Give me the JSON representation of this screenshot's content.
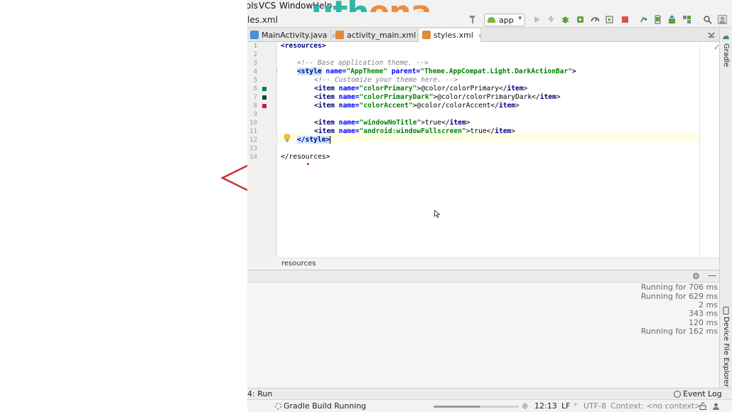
{
  "menu": {
    "items": [
      "ols",
      "VCS",
      "Window",
      "Help"
    ]
  },
  "logo": {
    "text": [
      "u",
      "t",
      "h",
      "e",
      "n",
      "a"
    ],
    "colors": [
      "#2fb6a6",
      "#2fb6a6",
      "#2fb6a6",
      "#f08a3a",
      "#f08a3a",
      "#f08a3a"
    ]
  },
  "toolbar": {
    "file_crumb": "les.xml",
    "run_config": "app",
    "icons": [
      "hammer-icon",
      "run-icon",
      "debug-icon",
      "apply-changes-icon",
      "profile-icon",
      "attach-icon",
      "stop-icon",
      "sync-gradle-icon",
      "avd-manager-icon",
      "sdk-manager-icon",
      "search-icon",
      "user-icon"
    ]
  },
  "tabs": [
    {
      "label": "MainActivity.java",
      "icon": "class-icon",
      "color": "#4a8fd6",
      "active": false
    },
    {
      "label": "activity_main.xml",
      "icon": "layout-icon",
      "color": "#e08a3a",
      "active": false
    },
    {
      "label": "styles.xml",
      "icon": "xml-icon",
      "color": "#e08a3a",
      "active": true
    }
  ],
  "editor": {
    "line_numbers": [
      "1",
      "2",
      "3",
      "4",
      "5",
      "6",
      "7",
      "8",
      "9",
      "10",
      "11",
      "12",
      "13",
      "14"
    ],
    "swatches": [
      {
        "line": 6,
        "color": "#0b7a5c"
      },
      {
        "line": 7,
        "color": "#08443a"
      },
      {
        "line": 8,
        "color": "#c2185b"
      }
    ],
    "lines": {
      "l1_tag": "<resources>",
      "l3_comment": "<!-- Base application theme. -->",
      "l4_open": "<style",
      "l4_attr1": " name=",
      "l4_val1": "\"AppTheme\"",
      "l4_attr2": " parent=",
      "l4_val2": "\"Theme.AppCompat.Light.DarkActionBar\"",
      "l4_close": ">",
      "l5_comment": "<!-- Customize your theme here. -->",
      "l6_open": "<item",
      "l6_attr": " name=",
      "l6_val": "\"colorPrimary\"",
      "l6_text": ">@color/colorPrimary</",
      "l6_end": "item",
      "l6_gt": ">",
      "l7_open": "<item",
      "l7_attr": " name=",
      "l7_val": "\"colorPrimaryDark\"",
      "l7_text": ">@color/colorPrimaryDark</",
      "l7_end": "item",
      "l7_gt": ">",
      "l8_open": "<item",
      "l8_attr": " name=",
      "l8_val": "\"colorAccent\"",
      "l8_text": ">@color/colorAccent</",
      "l8_end": "item",
      "l8_gt": ">",
      "l10_open": "<item",
      "l10_attr": " name=",
      "l10_val": "\"windowNoTitle\"",
      "l10_text": ">true</",
      "l10_end": "item",
      "l10_gt": ">",
      "l11_open": "<item",
      "l11_attr": " name=",
      "l11_val": "\"android:windowFullscreen\"",
      "l11_text": ">true</",
      "l11_end": "item",
      "l11_gt": ">",
      "l12_tag": "</style>",
      "l14_tag": "</resources>"
    },
    "breadcrumb": "resources"
  },
  "side_tabs": {
    "gradle": "Gradle",
    "device_explorer": "Device File Explorer"
  },
  "run_panel": {
    "rows": [
      "Running for 706 ms",
      "Running for 629 ms",
      "2 ms",
      "343 ms",
      "120 ms",
      "Running for 162 ms"
    ]
  },
  "tool_strip": {
    "run": "4: Run",
    "event_log": "Event Log"
  },
  "status": {
    "task": "Gradle Build Running",
    "progress": 0.55,
    "position": "12:13",
    "line_sep": "LF",
    "encoding": "UTF-8",
    "context": "Context: <no context>"
  }
}
